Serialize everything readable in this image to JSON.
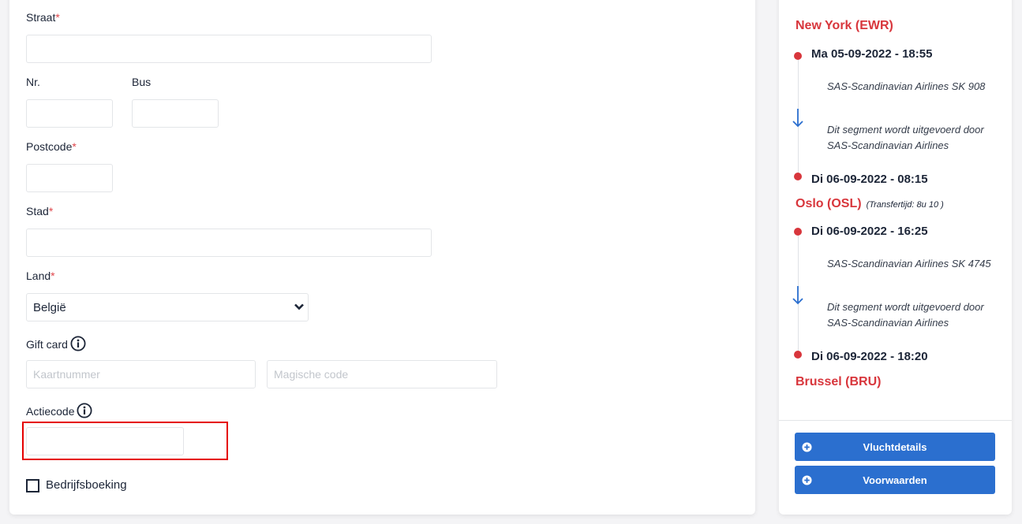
{
  "form": {
    "street": {
      "label": "Straat",
      "required_mark": "*",
      "value": ""
    },
    "number": {
      "label": "Nr.",
      "value": ""
    },
    "bus": {
      "label": "Bus",
      "value": ""
    },
    "postcode": {
      "label": "Postcode",
      "required_mark": "*",
      "value": ""
    },
    "city": {
      "label": "Stad",
      "required_mark": "*",
      "value": ""
    },
    "country": {
      "label": "Land",
      "required_mark": "*",
      "selected": "België"
    },
    "gift_card": {
      "label": "Gift card",
      "card_number_placeholder": "Kaartnummer",
      "magic_code_placeholder": "Magische code"
    },
    "promo_code": {
      "label": "Actiecode",
      "value": ""
    },
    "company_booking": {
      "label": "Bedrijfsboeking",
      "checked": false
    }
  },
  "itinerary": {
    "origin": "New York (EWR)",
    "segments": [
      {
        "departure": "Ma 05-09-2022 - 18:55",
        "flight": "SAS-Scandinavian Airlines SK 908",
        "operated_by": "Dit segment wordt uitgevoerd door SAS-Scandinavian Airlines",
        "arrival": "Di 06-09-2022 - 08:15"
      },
      {
        "departure": "Di 06-09-2022 - 16:25",
        "flight": "SAS-Scandinavian Airlines SK 4745",
        "operated_by": "Dit segment wordt uitgevoerd door SAS-Scandinavian Airlines",
        "arrival": "Di 06-09-2022 - 18:20"
      }
    ],
    "transfer_city": "Oslo (OSL)",
    "transfer_time": "(Transfertijd: 8u 10 )",
    "destination": "Brussel (BRU)"
  },
  "buttons": {
    "flight_details": "Vluchtdetails",
    "conditions": "Voorwaarden"
  },
  "colors": {
    "accent_red": "#d8363c",
    "button_blue": "#2b6fcf",
    "highlight": "#e50000"
  }
}
